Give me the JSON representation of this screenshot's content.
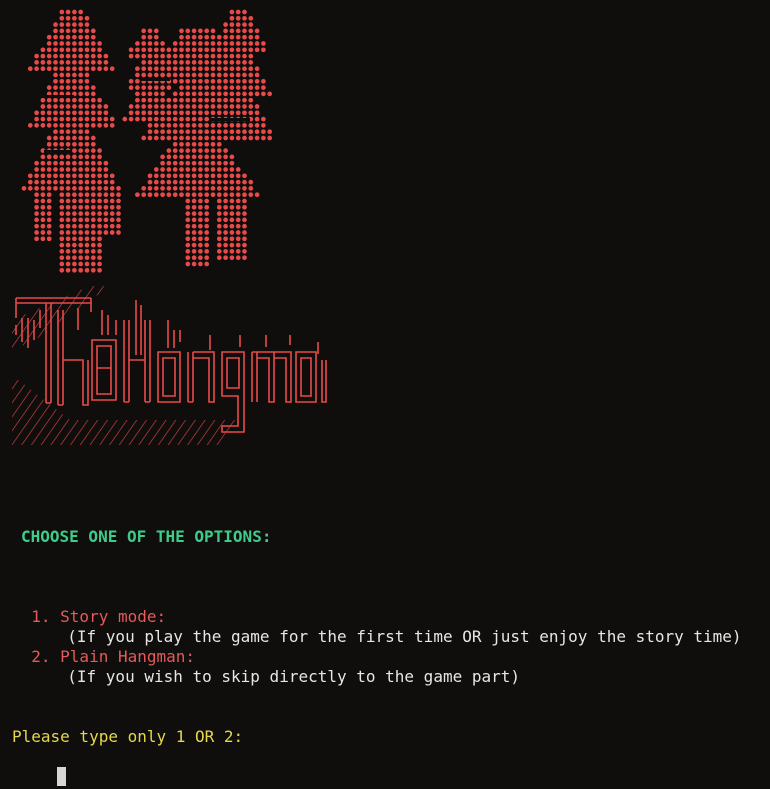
{
  "colors": {
    "background": "#0f0e0c",
    "art_red": "#e84a4a",
    "heading_green": "#3dcc8a",
    "option_red": "#e55a5a",
    "text_white": "#e6e6e6",
    "prompt_yellow": "#e6d84a"
  },
  "header_art": {
    "trees_icon": "pine-trees-ascii-art",
    "title_logo_icon": "hangman-ascii-logo"
  },
  "menu": {
    "heading": "CHOOSE ONE OF THE OPTIONS:",
    "options": [
      {
        "label": "1. Story mode:",
        "description": "(If you play the game for the first time OR just enjoy the story time)"
      },
      {
        "label": "2. Plain Hangman:",
        "description": "(If you wish to skip directly to the game part)"
      }
    ]
  },
  "prompt": {
    "text": "Please type only 1 OR 2:",
    "input_value": ""
  }
}
